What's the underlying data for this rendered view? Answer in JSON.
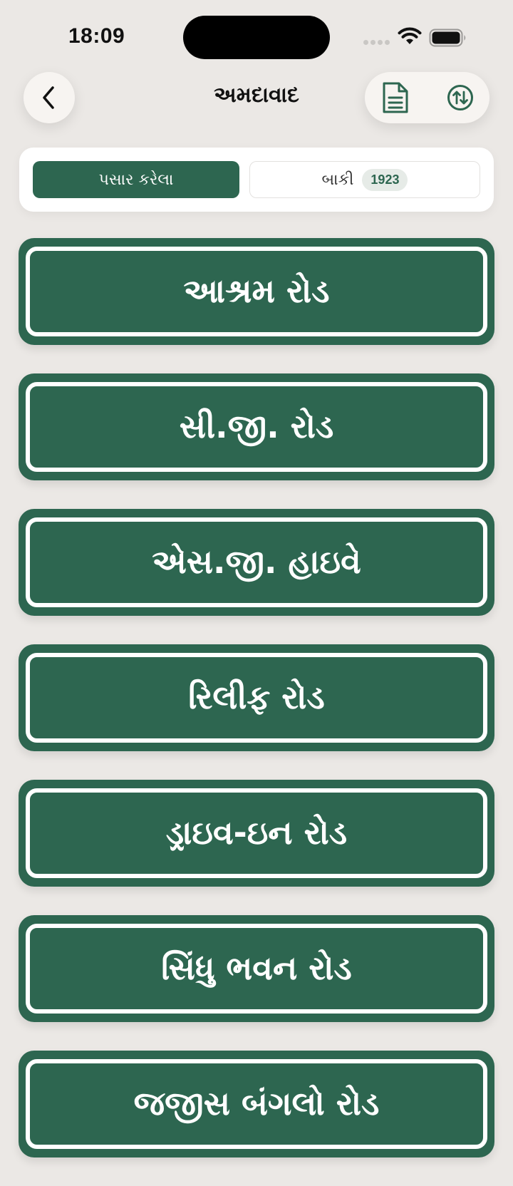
{
  "status_bar": {
    "time": "18:09"
  },
  "header": {
    "title": "અમદાવાદ",
    "back_icon": "chevron-left-icon",
    "doc_icon": "document-icon",
    "sort_icon": "sort-arrows-icon"
  },
  "tabs": {
    "passed_label": "પસાર કરેલા",
    "remaining_label": "બાકી",
    "remaining_count": "1923"
  },
  "roads": [
    {
      "name": "આશ્રમ રોડ"
    },
    {
      "name": "સી.જી. રોડ"
    },
    {
      "name": "એસ.જી. હાઇવે"
    },
    {
      "name": "રિલીફ રોડ"
    },
    {
      "name": "ડ્રાઇવ-ઇન રોડ"
    },
    {
      "name": "સિંધુ ભવન રોડ"
    },
    {
      "name": "જજીસ બંગલો રોડ"
    }
  ],
  "colors": {
    "accent": "#2d6650",
    "background": "#ebe8e5"
  }
}
